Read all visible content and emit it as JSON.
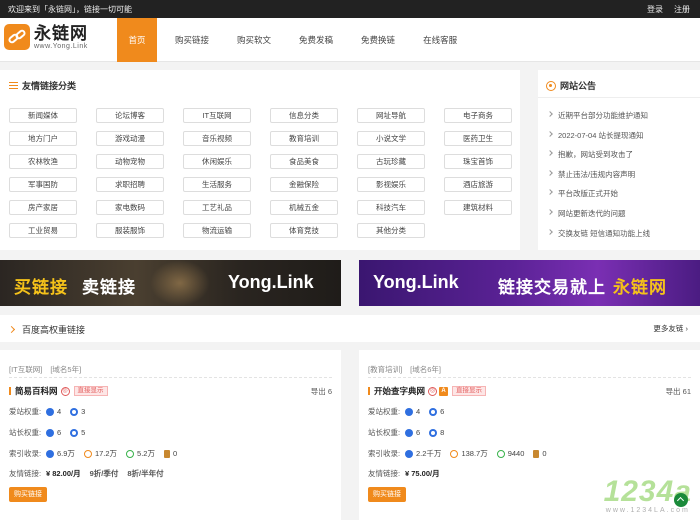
{
  "topbar": {
    "welcome": "欢迎来到「永链网」，链接一切可能",
    "login": "登录",
    "register": "注册"
  },
  "logo": {
    "cn": "永链网",
    "en": "www.Yong.Link"
  },
  "nav": [
    "首页",
    "购买链接",
    "购买软文",
    "免费发稿",
    "免费换链",
    "在线客服"
  ],
  "categories": {
    "title": "友情链接分类",
    "items": [
      "新闻媒体",
      "论坛博客",
      "IT互联网",
      "信息分类",
      "网址导航",
      "电子商务",
      "地方门户",
      "游戏动漫",
      "音乐视频",
      "教育培训",
      "小说文学",
      "医药卫生",
      "农林牧渔",
      "动物宠物",
      "休闲娱乐",
      "食品美食",
      "古玩珍藏",
      "珠宝首饰",
      "军事国防",
      "求职招聘",
      "生活服务",
      "金融保险",
      "影视娱乐",
      "酒店旅游",
      "房产家居",
      "家电数码",
      "工艺礼品",
      "机械五金",
      "科技汽车",
      "建筑材料",
      "工业贸易",
      "服装服饰",
      "物流运输",
      "体育竞技",
      "其他分类"
    ]
  },
  "notice": {
    "title": "网站公告",
    "items": [
      "近期平台部分功能维护通知",
      "2022-07-04 站长提现通知",
      "抱歉，网站受到攻击了",
      "禁止违法/违规内容声明",
      "平台改版正式开始",
      "网站更新迭代的问题",
      "交换友链 短信通知功能上线"
    ]
  },
  "banners": {
    "left": {
      "buy": "买链接",
      "sell": "卖链接",
      "domain": "Yong.Link"
    },
    "right": {
      "domain": "Yong.Link",
      "slogan": "链接交易就上",
      "brand": "永链网"
    }
  },
  "section": {
    "title": "百度高权重链接",
    "more": "更多友链 ›"
  },
  "cards": [
    {
      "tags": [
        "[IT互联网]",
        "[域名5年]"
      ],
      "name": "简易百科网",
      "badge": "直接显示",
      "out_label": "导出 6",
      "weight_label": "爱站权重:",
      "weight_a": "4",
      "weight_b": "3",
      "site_label": "站长权重:",
      "site_a": "6",
      "site_b": "5",
      "index_label": "索引收录:",
      "idx1": "6.9万",
      "idx2": "17.2万",
      "idx3": "5.2万",
      "idx4": "0",
      "price_label": "友情链接:",
      "price": "¥ 82.00/月",
      "discount1": "9折/季付",
      "discount2": "8折/半年付",
      "buy": "购买链接"
    },
    {
      "tags": [
        "[教育培训]",
        "[域名6年]"
      ],
      "name": "开始查字典网",
      "badge": "直接显示",
      "out_label": "导出 61",
      "weight_label": "爱站权重:",
      "weight_a": "4",
      "weight_b": "6",
      "site_label": "站长权重:",
      "site_a": "6",
      "site_b": "8",
      "index_label": "索引收录:",
      "idx1": "2.2千万",
      "idx2": "138.7万",
      "idx3": "9440",
      "idx4": "0",
      "price_label": "友情链接:",
      "price": "¥ 75.00/月",
      "buy": "购买链接"
    }
  ],
  "watermark": {
    "main": "1234a",
    "sub": "www.1234LA.com"
  },
  "colors": {
    "accent": "#f08a1c",
    "topbar": "#222222",
    "brand_yellow": "#f5c21a",
    "banner_purple": "#5b2296"
  }
}
